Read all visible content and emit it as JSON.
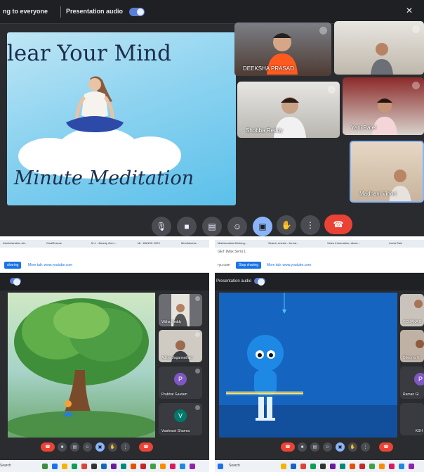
{
  "top": {
    "banner_left": "ng to everyone",
    "banner_audio": "Presentation audio",
    "slide": {
      "title": "lear Your Mind",
      "subtitle": "Minute Meditation"
    },
    "participants": [
      {
        "name": "DEEKSHA PRASAD"
      },
      {
        "name": ""
      },
      {
        "name": "Shobba Reddy"
      },
      {
        "name": "Yani Patel"
      },
      {
        "name": "Madhavi Vinod"
      }
    ],
    "controls": [
      "mic-icon",
      "camera-icon",
      "captions-icon",
      "emoji-icon",
      "present-icon",
      "hand-icon",
      "more-icon",
      "end-call-icon"
    ]
  },
  "left_pane": {
    "tabs": [
      "Administration att...",
      "GoalRescue",
      "M-1 - Beauty Gem...",
      "Mt - BANSK 2023",
      "Mindfulness..."
    ],
    "stop_label": "sharing",
    "link_label": "More tab: www.youtube.com",
    "participants": [
      {
        "name": "Vibha Reddy"
      },
      {
        "name": "Aditya Jagannathan"
      },
      {
        "name": "Prabhat Gautam",
        "initial": "P",
        "color": "#7e57c2"
      },
      {
        "name": "Vaishnavi Sharma",
        "initial": "V",
        "color": "#00796b"
      }
    ],
    "taskbar_search": "Search"
  },
  "right_pane": {
    "tabs": [
      "Mathematical thinking...",
      "Search results - Jenna...",
      "Video Information: about...",
      "Leela Rain"
    ],
    "url": "ryu.com",
    "breadcrumb": "GET (Max Sem) 1",
    "stop_label": "Stop sharing",
    "link_label": "More tab: www.youtube.com",
    "audio_label": "Presentation audio",
    "participants": [
      {
        "name": "GOUANA G"
      },
      {
        "name": "Dhoorya K"
      },
      {
        "name": "Raman Gl",
        "initial": "P",
        "color": "#7e57c2"
      },
      {
        "name": "KSH"
      }
    ],
    "taskbar_search": "Search"
  },
  "colors": {
    "accent": "#8ab4f8",
    "end_call": "#ea4335",
    "meet_bg": "#202124"
  }
}
